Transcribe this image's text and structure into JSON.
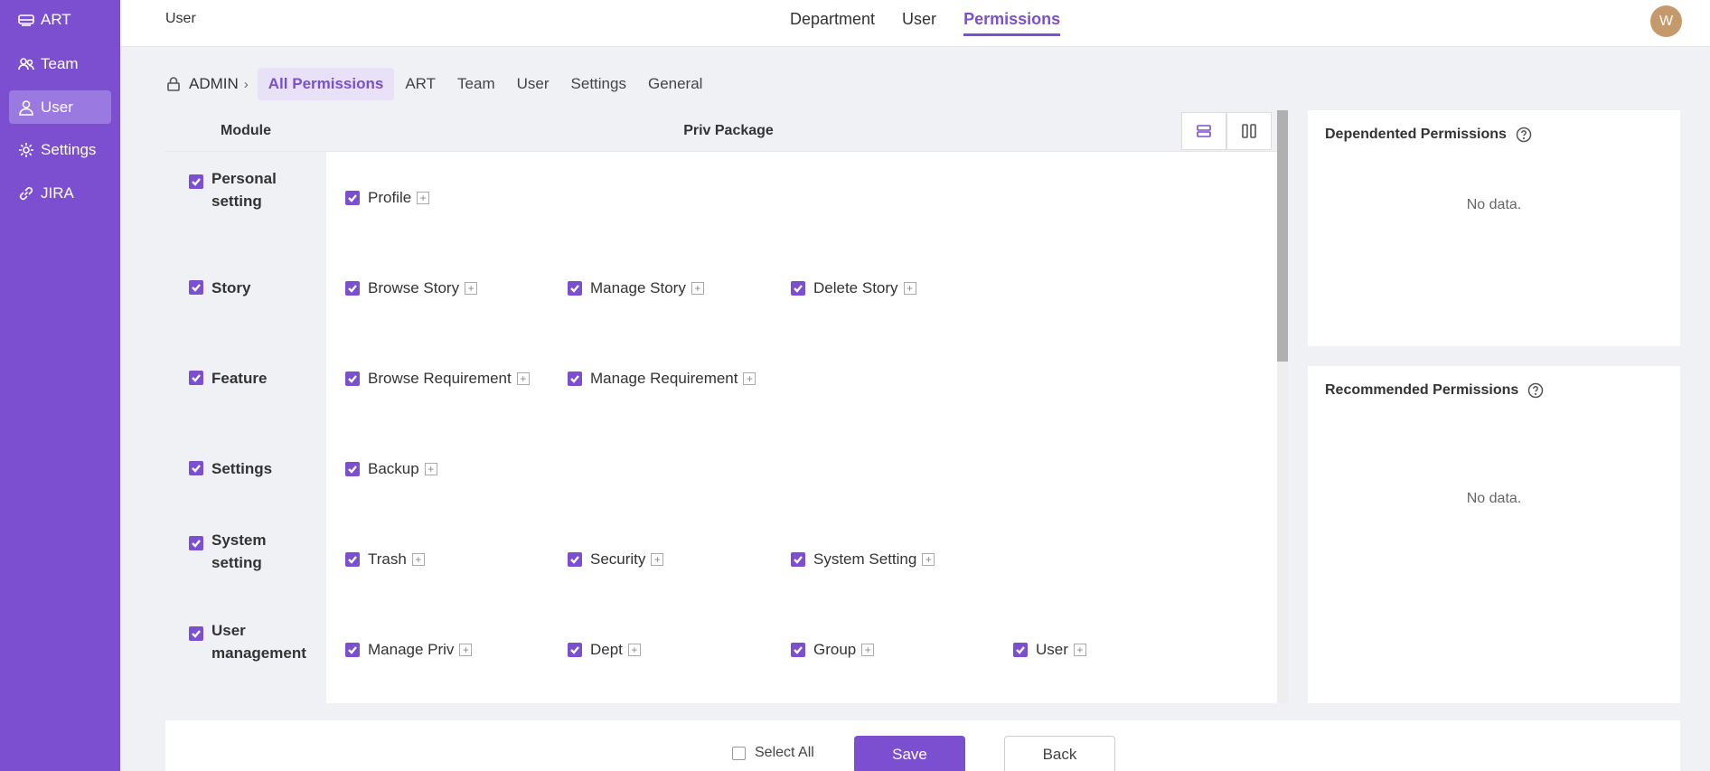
{
  "sidebar": {
    "items": [
      {
        "label": "ART",
        "icon": "train-icon"
      },
      {
        "label": "Team",
        "icon": "team-icon"
      },
      {
        "label": "User",
        "icon": "user-icon"
      },
      {
        "label": "Settings",
        "icon": "gear-icon"
      },
      {
        "label": "JIRA",
        "icon": "link-icon"
      }
    ],
    "active": "User"
  },
  "header": {
    "breadcrumb": "User",
    "nav": [
      "Department",
      "User",
      "Permissions"
    ],
    "active_nav": "Permissions",
    "avatar_initial": "W"
  },
  "subtabs": {
    "root": "ADMIN",
    "tabs": [
      "All Permissions",
      "ART",
      "Team",
      "User",
      "Settings",
      "General"
    ],
    "active": "All Permissions"
  },
  "table": {
    "columns": [
      "Module",
      "Priv Package"
    ],
    "rows": [
      {
        "module": "Personal setting",
        "privs": [
          "Profile"
        ]
      },
      {
        "module": "Story",
        "privs": [
          "Browse Story",
          "Manage Story",
          "Delete Story"
        ]
      },
      {
        "module": "Feature",
        "privs": [
          "Browse Requirement",
          "Manage Requirement"
        ]
      },
      {
        "module": "Settings",
        "privs": [
          "Backup"
        ]
      },
      {
        "module": "System setting",
        "privs": [
          "Trash",
          "Security",
          "System Setting"
        ]
      },
      {
        "module": "User management",
        "privs": [
          "Manage Priv",
          "Dept",
          "Group",
          "User"
        ]
      }
    ]
  },
  "panels": {
    "dependented": {
      "title": "Dependented Permissions",
      "empty": "No data."
    },
    "recommended": {
      "title": "Recommended Permissions",
      "empty": "No data."
    }
  },
  "footer": {
    "select_all": "Select All",
    "save": "Save",
    "back": "Back"
  },
  "colors": {
    "accent": "#7b4fd0",
    "sidebar_bg": "#7b4fd0",
    "avatar_bg": "#c49a6c"
  }
}
